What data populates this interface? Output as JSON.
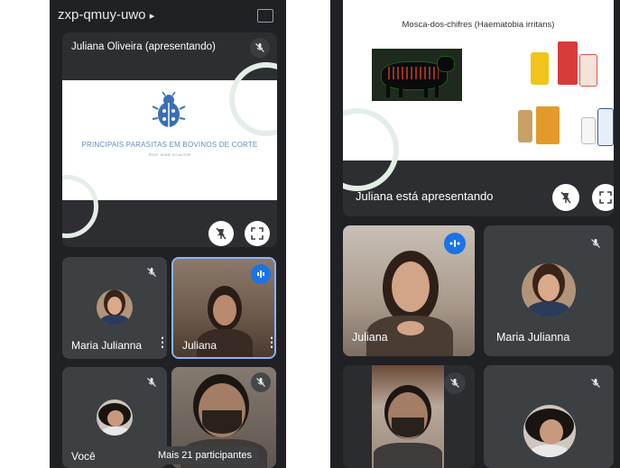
{
  "meeting": {
    "code": "zxp-qmuy-uwo",
    "code_chevron": "▸"
  },
  "left": {
    "presentation_tile": {
      "presenter_label": "Juliana Oliveira (apresentando)",
      "slide_title": "PRINCIPAIS PARASITAS EM BOVINOS DE CORTE",
      "slide_subtitle": "PROF. NOME DO AUTOR"
    },
    "participants": [
      {
        "name": "Maria Julianna"
      },
      {
        "name": "Juliana"
      },
      {
        "name": "Você"
      }
    ],
    "more_participants_label": "Mais 21 participantes"
  },
  "right": {
    "presentation": {
      "slide_heading": "Mosca-dos-chifres (Haematobia irritans)",
      "presenting_label": "Juliana está apresentando"
    },
    "participants": [
      {
        "name": "Juliana"
      },
      {
        "name": "Maria Julianna"
      }
    ]
  },
  "colors": {
    "accent": "#1a73e8",
    "background": "#202124",
    "tile": "#3c4043"
  }
}
